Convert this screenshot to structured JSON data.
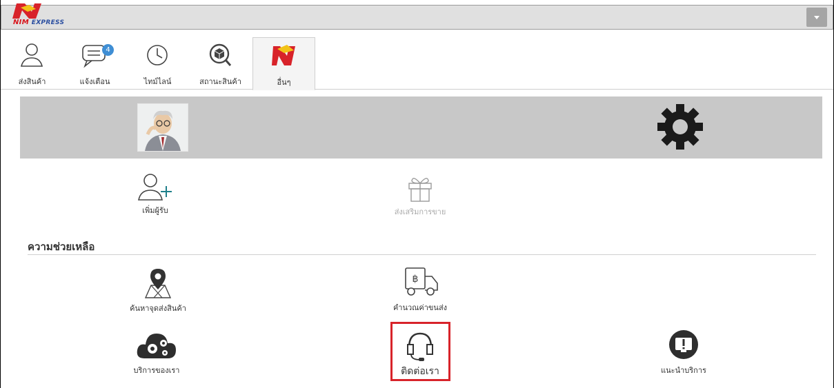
{
  "app": {
    "logo_text_main": "NIM",
    "logo_text_sub": "EXPRESS"
  },
  "tabs": [
    {
      "id": "send",
      "label": "ส่งสินค้า",
      "icon": "person-icon"
    },
    {
      "id": "notify",
      "label": "แจ้งเตือน",
      "icon": "chat-bubble-icon",
      "badge": "4"
    },
    {
      "id": "timeline",
      "label": "ไทม์ไลน์",
      "icon": "clock-icon"
    },
    {
      "id": "status",
      "label": "สถานะสินค้า",
      "icon": "box-search-icon"
    },
    {
      "id": "other",
      "label": "อื่นๆ",
      "icon": "nim-logo-icon",
      "active": true
    }
  ],
  "tiles": {
    "add_recipient": "เพิ่มผู้รับ",
    "promotion": "ส่งเสริมการขาย"
  },
  "help": {
    "title": "ความช่วยเหลือ",
    "find_location": "ค้นหาจุดส่งสินค้า",
    "calculate": "คำนวณค่าขนส่ง",
    "services": "บริการของเรา",
    "contact": "ติดต่อเรา",
    "suggest": "แนะนำบริการ"
  },
  "colors": {
    "accent_red": "#d8232a",
    "badge_blue": "#3f8ed4",
    "profile_band": "#c8c8c8"
  }
}
